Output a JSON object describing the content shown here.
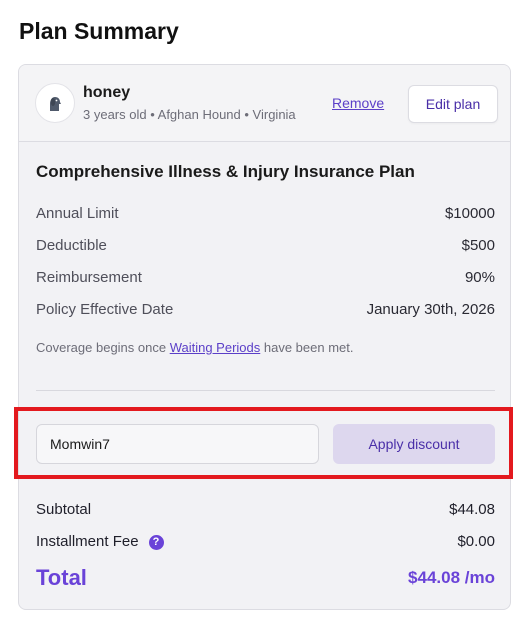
{
  "page": {
    "title": "Plan Summary"
  },
  "pet": {
    "name": "honey",
    "details": "3 years old • Afghan Hound • Virginia",
    "remove_label": "Remove",
    "edit_label": "Edit plan"
  },
  "plan": {
    "name": "Comprehensive Illness & Injury Insurance Plan",
    "rows": [
      {
        "label": "Annual Limit",
        "value": "$10000"
      },
      {
        "label": "Deductible",
        "value": "$500"
      },
      {
        "label": "Reimbursement",
        "value": "90%"
      },
      {
        "label": "Policy Effective Date",
        "value": "January 30th, 2026"
      }
    ],
    "coverage_prefix": "Coverage begins once ",
    "coverage_link": "Waiting Periods",
    "coverage_suffix": " have been met."
  },
  "discount": {
    "value": "Momwin7",
    "apply_label": "Apply discount"
  },
  "summary": {
    "subtotal_label": "Subtotal",
    "subtotal_value": "$44.08",
    "fee_label": "Installment Fee",
    "fee_help": "?",
    "fee_value": "$0.00",
    "total_label": "Total",
    "total_value": "$44.08 /mo"
  },
  "colors": {
    "accent": "#6a43d8",
    "link": "#5b3fc8",
    "highlight": "#e3191e"
  }
}
